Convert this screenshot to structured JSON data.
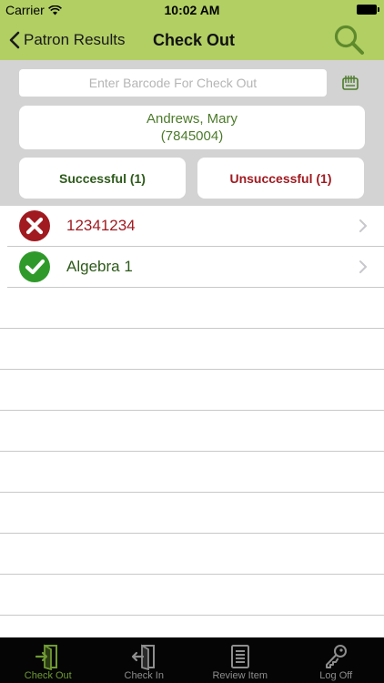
{
  "status_bar": {
    "carrier": "Carrier",
    "time": "10:02 AM"
  },
  "nav": {
    "back_label": "Patron Results",
    "title": "Check Out"
  },
  "barcode": {
    "placeholder": "Enter Barcode For Check Out",
    "value": ""
  },
  "patron": {
    "name": "Andrews, Mary",
    "id": "(7845004)"
  },
  "results": {
    "successful_label": "Successful (1)",
    "unsuccessful_label": "Unsuccessful (1)"
  },
  "items": [
    {
      "label": "12341234",
      "status": "unsuccessful",
      "icon": "error-x-icon"
    },
    {
      "label": "Algebra 1",
      "status": "successful",
      "icon": "success-check-icon"
    }
  ],
  "tabs": [
    {
      "label": "Check Out",
      "icon": "check-out-icon",
      "active": true
    },
    {
      "label": "Check In",
      "icon": "check-in-icon",
      "active": false
    },
    {
      "label": "Review Item",
      "icon": "review-item-icon",
      "active": false
    },
    {
      "label": "Log Off",
      "icon": "key-icon",
      "active": false
    }
  ],
  "colors": {
    "accent": "#b2cf64",
    "success": "#2d5a1a",
    "failure": "#a01a20",
    "header_bg": "#d3d3d3",
    "tabbar_bg": "#050505"
  }
}
